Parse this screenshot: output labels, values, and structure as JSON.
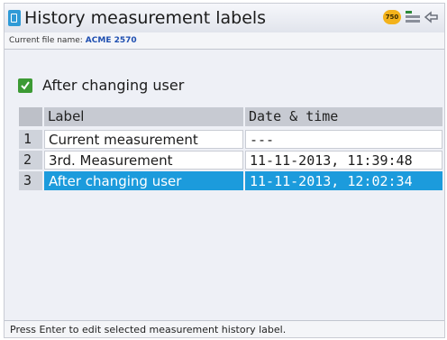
{
  "window": {
    "title": "History measurement labels",
    "status_badge": "750",
    "icons": [
      "app-icon",
      "battery-badge-icon",
      "status-grid-icon",
      "back-arrow-icon"
    ]
  },
  "file_info": {
    "label": "Current file name:",
    "name": "ACME 2570"
  },
  "filter": {
    "checked": true,
    "label": "After changing user"
  },
  "table": {
    "columns": [
      "Label",
      "Date & time"
    ],
    "rows": [
      {
        "index": "1",
        "label": "Current measurement",
        "datetime": "---",
        "selected": false
      },
      {
        "index": "2",
        "label": "3rd. Measurement",
        "datetime": "11-11-2013, 11:39:48",
        "selected": false
      },
      {
        "index": "3",
        "label": "After changing user",
        "datetime": "11-11-2013, 12:02:34",
        "selected": true
      }
    ]
  },
  "footer": {
    "hint": "Press Enter to edit selected measurement history label."
  },
  "colors": {
    "selection": "#1c9bdc",
    "checkbox": "#3c9a34",
    "badge": "#f3b21b"
  }
}
